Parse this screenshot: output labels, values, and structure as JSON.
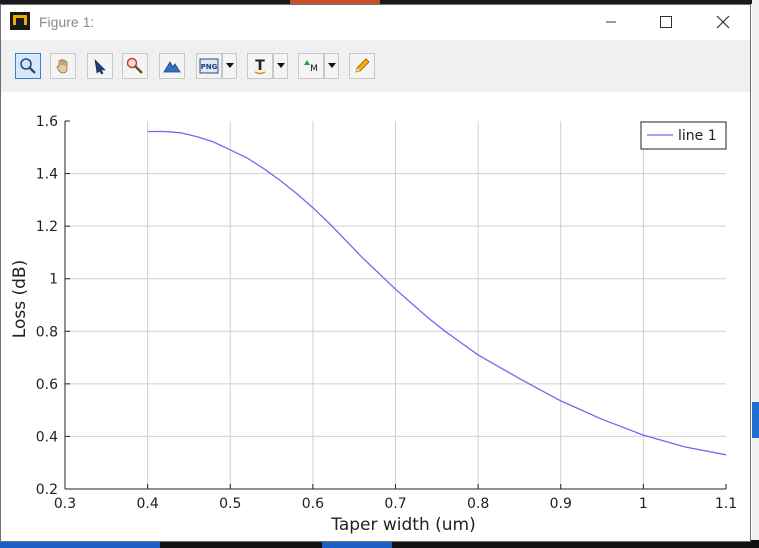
{
  "window": {
    "title": "Figure 1:"
  },
  "toolbar": {
    "tools": [
      {
        "name": "zoom-tool",
        "icon": "magnifier-icon"
      },
      {
        "name": "pan-tool",
        "icon": "hand-icon"
      },
      {
        "name": "select-tool",
        "icon": "arrow-cursor-icon"
      },
      {
        "name": "zoom-point-tool",
        "icon": "zoom-brush-icon"
      },
      {
        "name": "view-tool",
        "icon": "mountain-icon"
      },
      {
        "name": "export-png-tool",
        "icon": "png-icon",
        "label": "PNG"
      },
      {
        "name": "text-tool",
        "icon": "text-t-icon",
        "label": "T"
      },
      {
        "name": "marker-tool",
        "icon": "marker-m-icon",
        "label": "M"
      },
      {
        "name": "edit-tool",
        "icon": "pencil-icon"
      }
    ]
  },
  "colors": {
    "line": "#6a6cf0",
    "grid": "#d0d0d0",
    "accent_active": "#3b7fd0"
  },
  "chart_data": {
    "type": "line",
    "xlabel": "Taper width (um)",
    "ylabel": "Loss (dB)",
    "xlim": [
      0.3,
      1.1
    ],
    "ylim": [
      0.2,
      1.6
    ],
    "xticks": [
      "0.3",
      "0.4",
      "0.5",
      "0.6",
      "0.7",
      "0.8",
      "0.9",
      "1",
      "1.1"
    ],
    "yticks": [
      "0.2",
      "0.4",
      "0.6",
      "0.8",
      "1",
      "1.2",
      "1.4",
      "1.6"
    ],
    "grid": true,
    "legend_position": "top-right",
    "series": [
      {
        "name": "line 1",
        "x": [
          0.4,
          0.42,
          0.44,
          0.46,
          0.48,
          0.5,
          0.52,
          0.54,
          0.56,
          0.58,
          0.6,
          0.62,
          0.64,
          0.66,
          0.68,
          0.7,
          0.72,
          0.74,
          0.76,
          0.78,
          0.8,
          0.85,
          0.9,
          0.95,
          1.0,
          1.05,
          1.1
        ],
        "y": [
          1.56,
          1.56,
          1.555,
          1.54,
          1.52,
          1.49,
          1.46,
          1.42,
          1.375,
          1.325,
          1.27,
          1.21,
          1.145,
          1.08,
          1.02,
          0.96,
          0.905,
          0.85,
          0.8,
          0.755,
          0.71,
          0.62,
          0.535,
          0.465,
          0.405,
          0.36,
          0.33
        ]
      }
    ]
  }
}
